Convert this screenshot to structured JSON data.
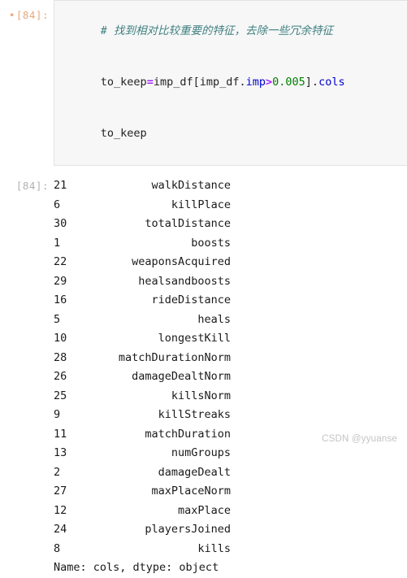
{
  "notebook": {
    "input_cell": {
      "modified_marker": "•",
      "prompt": "[84]:",
      "lines": [
        {
          "id": "line-comment",
          "tokens": [
            {
              "text": "# 找到相对比较重要的特征，去除一些冗余特征",
              "type": "comment"
            }
          ]
        },
        {
          "id": "line-assign",
          "tokens": [
            {
              "text": "to_keep",
              "type": "plain"
            },
            {
              "text": "=",
              "type": "op"
            },
            {
              "text": "imp_df[imp_df.",
              "type": "plain"
            },
            {
              "text": "imp",
              "type": "attr"
            },
            {
              "text": ">",
              "type": "op"
            },
            {
              "text": "0.005",
              "type": "num"
            },
            {
              "text": "].",
              "type": "plain"
            },
            {
              "text": "cols",
              "type": "attr"
            }
          ]
        },
        {
          "id": "line-display",
          "tokens": [
            {
              "text": "to_keep",
              "type": "plain"
            }
          ]
        }
      ]
    },
    "output_cell": {
      "prompt": "[84]:",
      "series": {
        "rows": [
          {
            "index": "21",
            "value": "walkDistance"
          },
          {
            "index": "6",
            "value": "killPlace"
          },
          {
            "index": "30",
            "value": "totalDistance"
          },
          {
            "index": "1",
            "value": "boosts"
          },
          {
            "index": "22",
            "value": "weaponsAcquired"
          },
          {
            "index": "29",
            "value": "healsandboosts"
          },
          {
            "index": "16",
            "value": "rideDistance"
          },
          {
            "index": "5",
            "value": "heals"
          },
          {
            "index": "10",
            "value": "longestKill"
          },
          {
            "index": "28",
            "value": "matchDurationNorm"
          },
          {
            "index": "26",
            "value": "damageDealtNorm"
          },
          {
            "index": "25",
            "value": "killsNorm"
          },
          {
            "index": "9",
            "value": "killStreaks"
          },
          {
            "index": "11",
            "value": "matchDuration"
          },
          {
            "index": "13",
            "value": "numGroups"
          },
          {
            "index": "2",
            "value": "damageDealt"
          },
          {
            "index": "27",
            "value": "maxPlaceNorm"
          },
          {
            "index": "12",
            "value": "maxPlace"
          },
          {
            "index": "24",
            "value": "playersJoined"
          },
          {
            "index": "8",
            "value": "kills"
          }
        ],
        "footer": "Name: cols, dtype: object"
      }
    }
  },
  "watermark": {
    "text": "CSDN @yyuanse"
  },
  "colors": {
    "input_prompt": "#e8a87c",
    "output_prompt": "#b0b0b0",
    "code_background": "#f7f7f7",
    "comment": "#408080",
    "operator": "#aa22ff",
    "attribute": "#0000cf",
    "number": "#007f00",
    "text": "#1a1a1a",
    "watermark": "#c4c4c4"
  }
}
